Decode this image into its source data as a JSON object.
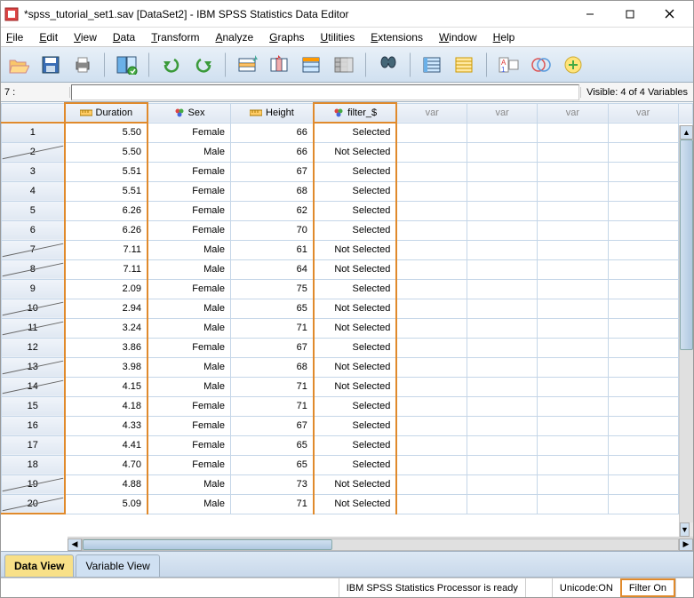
{
  "window": {
    "title": "*spss_tutorial_set1.sav [DataSet2] - IBM SPSS Statistics Data Editor"
  },
  "menu": [
    "File",
    "Edit",
    "View",
    "Data",
    "Transform",
    "Analyze",
    "Graphs",
    "Utilities",
    "Extensions",
    "Window",
    "Help"
  ],
  "info": {
    "cell_indicator": "7 :",
    "cell_value": "",
    "visible": "Visible: 4 of 4 Variables"
  },
  "columns": {
    "duration": "Duration",
    "sex": "Sex",
    "height": "Height",
    "filter": "filter_$",
    "var": "var"
  },
  "rows": [
    {
      "n": 1,
      "strike": false,
      "duration": "5.50",
      "sex": "Female",
      "height": "66",
      "filter": "Selected"
    },
    {
      "n": 2,
      "strike": true,
      "duration": "5.50",
      "sex": "Male",
      "height": "66",
      "filter": "Not Selected"
    },
    {
      "n": 3,
      "strike": false,
      "duration": "5.51",
      "sex": "Female",
      "height": "67",
      "filter": "Selected"
    },
    {
      "n": 4,
      "strike": false,
      "duration": "5.51",
      "sex": "Female",
      "height": "68",
      "filter": "Selected"
    },
    {
      "n": 5,
      "strike": false,
      "duration": "6.26",
      "sex": "Female",
      "height": "62",
      "filter": "Selected"
    },
    {
      "n": 6,
      "strike": false,
      "duration": "6.26",
      "sex": "Female",
      "height": "70",
      "filter": "Selected"
    },
    {
      "n": 7,
      "strike": true,
      "duration": "7.11",
      "sex": "Male",
      "height": "61",
      "filter": "Not Selected"
    },
    {
      "n": 8,
      "strike": true,
      "duration": "7.11",
      "sex": "Male",
      "height": "64",
      "filter": "Not Selected"
    },
    {
      "n": 9,
      "strike": false,
      "duration": "2.09",
      "sex": "Female",
      "height": "75",
      "filter": "Selected"
    },
    {
      "n": 10,
      "strike": true,
      "duration": "2.94",
      "sex": "Male",
      "height": "65",
      "filter": "Not Selected"
    },
    {
      "n": 11,
      "strike": true,
      "duration": "3.24",
      "sex": "Male",
      "height": "71",
      "filter": "Not Selected"
    },
    {
      "n": 12,
      "strike": false,
      "duration": "3.86",
      "sex": "Female",
      "height": "67",
      "filter": "Selected"
    },
    {
      "n": 13,
      "strike": true,
      "duration": "3.98",
      "sex": "Male",
      "height": "68",
      "filter": "Not Selected"
    },
    {
      "n": 14,
      "strike": true,
      "duration": "4.15",
      "sex": "Male",
      "height": "71",
      "filter": "Not Selected"
    },
    {
      "n": 15,
      "strike": false,
      "duration": "4.18",
      "sex": "Female",
      "height": "71",
      "filter": "Selected"
    },
    {
      "n": 16,
      "strike": false,
      "duration": "4.33",
      "sex": "Female",
      "height": "67",
      "filter": "Selected"
    },
    {
      "n": 17,
      "strike": false,
      "duration": "4.41",
      "sex": "Female",
      "height": "65",
      "filter": "Selected"
    },
    {
      "n": 18,
      "strike": false,
      "duration": "4.70",
      "sex": "Female",
      "height": "65",
      "filter": "Selected"
    },
    {
      "n": 19,
      "strike": true,
      "duration": "4.88",
      "sex": "Male",
      "height": "73",
      "filter": "Not Selected"
    },
    {
      "n": 20,
      "strike": true,
      "duration": "5.09",
      "sex": "Male",
      "height": "71",
      "filter": "Not Selected"
    }
  ],
  "tabs": {
    "data": "Data View",
    "variable": "Variable View"
  },
  "status": {
    "processor": "IBM SPSS Statistics Processor is ready",
    "unicode": "Unicode:ON",
    "filter": "Filter On"
  },
  "toolbar_icons": [
    "open-icon",
    "save-icon",
    "print-icon",
    "recall-icon",
    "undo-icon",
    "redo-icon",
    "goto-case-icon",
    "goto-variable-icon",
    "variables-icon",
    "run-icon",
    "find-icon",
    "insert-case-icon",
    "insert-variable-icon",
    "split-icon",
    "weight-icon",
    "value-labels-icon"
  ]
}
